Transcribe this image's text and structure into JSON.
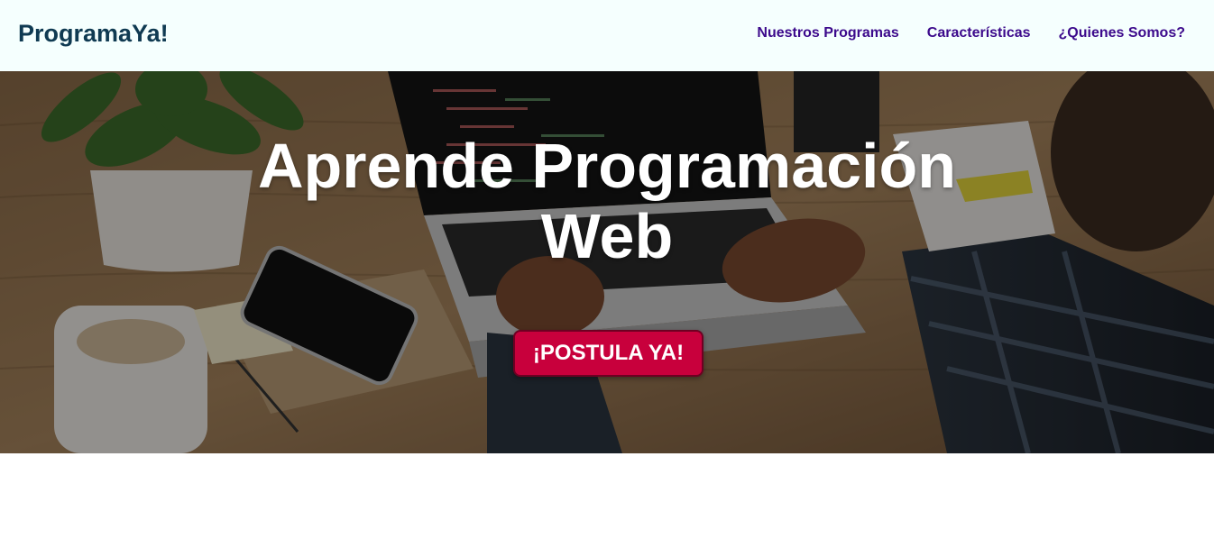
{
  "navbar": {
    "brand": "ProgramaYa!",
    "links": [
      {
        "label": "Nuestros Programas"
      },
      {
        "label": "Características"
      },
      {
        "label": "¿Quienes Somos?"
      }
    ]
  },
  "hero": {
    "image_description_icon": "laptop-coding-photo",
    "title_line1": "Aprende Programación",
    "title_line2": "Web",
    "cta_label": "¡POSTULA YA!"
  },
  "colors": {
    "navbar_bg": "#f5fffe",
    "brand": "#0f3a52",
    "nav_link": "#3c0a8c",
    "cta_bg": "#c8003c",
    "hero_text": "#ffffff"
  }
}
